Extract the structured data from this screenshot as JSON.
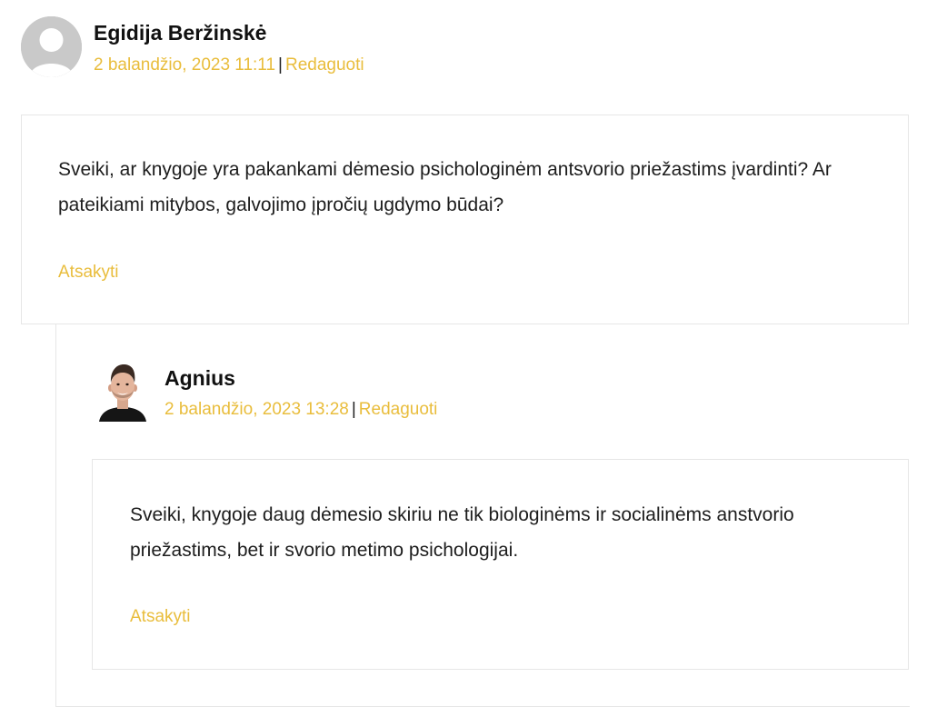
{
  "comments": [
    {
      "author": "Egidija Beržinskė",
      "date": "2 balandžio, 2023 11:11",
      "edit_label": "Redaguoti",
      "text": "Sveiki, ar knygoje yra pakankami dėmesio psichologinėm antsvorio priežastims įvardinti? Ar pateikiami mitybos, galvojimo įpročių ugdymo būdai?",
      "reply_label": "Atsakyti",
      "avatar_icon": "default-user-avatar-icon"
    },
    {
      "author": "Agnius",
      "date": "2 balandžio, 2023 13:28",
      "edit_label": "Redaguoti",
      "text": "Sveiki, knygoje daug dėmesio skiriu ne tik biologinėms ir socialinėms anstvorio priežastims, bet ir svorio metimo psichologijai.",
      "reply_label": "Atsakyti",
      "avatar_icon": "user-photo-avatar"
    }
  ],
  "separator": "|",
  "colors": {
    "accent": "#e9bd3c",
    "border": "#e6e6e6",
    "avatar_bg": "#c9c9c9",
    "text": "#1d1d1d"
  }
}
